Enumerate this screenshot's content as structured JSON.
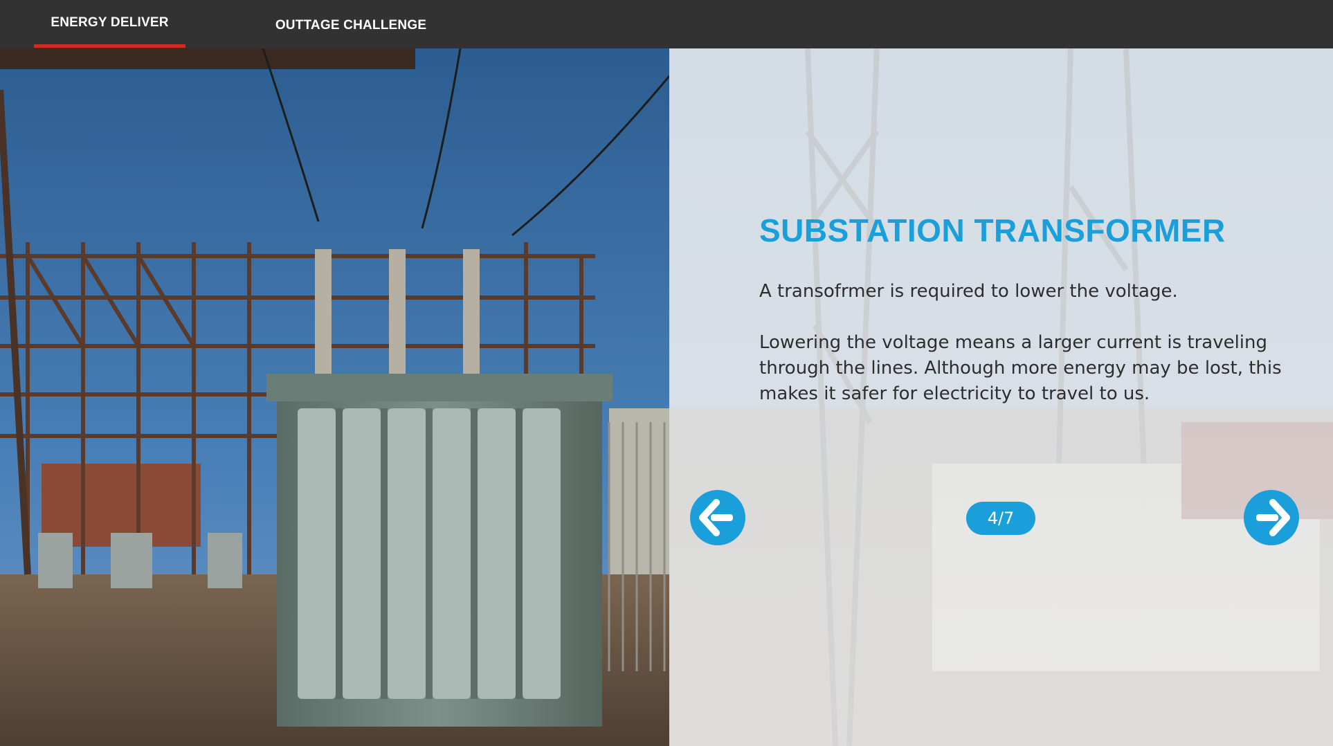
{
  "tabs": [
    {
      "label": "ENERGY DELIVER",
      "active": true
    },
    {
      "label": "OUTTAGE CHALLENGE",
      "active": false
    }
  ],
  "slide": {
    "title": "SUBSTATION TRANSFORMER",
    "paragraph_1": "A transofrmer is required to lower the voltage.",
    "paragraph_2": "Lowering the voltage means a larger current is traveling through the lines. Although more energy may be lost, this makes it safer for electricity to travel to us."
  },
  "pager": {
    "current": 4,
    "total": 7,
    "label": "4/7",
    "prev_icon": "arrow-left-icon",
    "next_icon": "arrow-right-icon"
  },
  "colors": {
    "accent": "#1b9fdb",
    "tab_underline": "#d22a25",
    "topbar": "#323232",
    "body_text": "#2d2d2d"
  },
  "images": {
    "left": "substation-transformer-photo",
    "right_background": "utility-truck-tower-photo"
  }
}
